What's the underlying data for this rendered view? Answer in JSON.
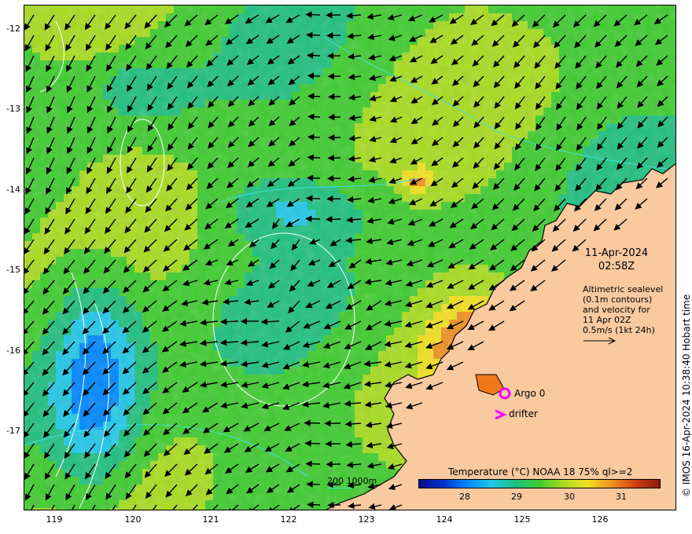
{
  "map": {
    "y_ticks": [
      "-12",
      "-13",
      "-14",
      "-15",
      "-16",
      "-17"
    ],
    "x_ticks": [
      "119",
      "120",
      "121",
      "122",
      "123",
      "124",
      "125",
      "126"
    ],
    "lon_range": [
      118.6,
      126.9
    ],
    "lat_range": [
      -11.7,
      -17.95
    ],
    "date": "11-Apr-2024",
    "time": "02:58Z",
    "description": [
      "Altimetric sealevel",
      "(0.1m contours)",
      "and velocity for",
      "11 Apr 02Z",
      "0.5m/s (1kt 24h)"
    ],
    "credit": "© IMOS 16-Apr-2024 10:38:40 Hobart time",
    "argo_label": "Argo 0",
    "drifter_label": "drifter",
    "depth_label": "200  1000m",
    "colors": {
      "land": "#f9c9a0",
      "marker": "#ff00ff",
      "depth_contour": "#40e0e0",
      "sealevel_contour": "#ffffff"
    }
  },
  "colorbar": {
    "title": "Temperature (°C) NOAA 18 75% ql>=2",
    "ticks": [
      "28",
      "29",
      "30",
      "31"
    ],
    "range": [
      27.2,
      31.8
    ]
  }
}
